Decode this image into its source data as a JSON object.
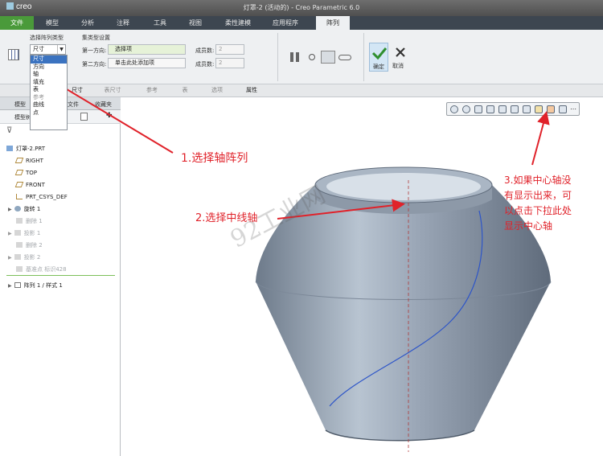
{
  "app": {
    "logo": "creo",
    "title": "灯罩-2 (活动的) - Creo Parametric 6.0"
  },
  "tabs": [
    "文件",
    "模型",
    "分析",
    "注释",
    "工具",
    "视图",
    "柔性建模",
    "应用程序",
    "阵列"
  ],
  "ribbon": {
    "pattern_type_label": "选择阵列类型",
    "pattern_type_value": "尺寸",
    "set_type_label": "集类型设置",
    "dir1_label": "第一方向:",
    "dir1_value": "选择项",
    "dir2_label": "第二方向:",
    "dir2_value": "单击此处添加项",
    "members_label1": "成员数:",
    "members_label2": "成员数:",
    "members_value1": "2",
    "members_value2": "2",
    "ok_label": "确定",
    "cancel_label": "取消"
  },
  "dropdown": {
    "items": [
      "尺寸",
      "方向",
      "轴",
      "填充",
      "表",
      "参考",
      "曲线",
      "点"
    ]
  },
  "subtabs": [
    "尺寸",
    "表尺寸",
    "参考",
    "表",
    "选项",
    "属性"
  ],
  "panel": {
    "tabs": [
      "模型",
      "文件",
      "收藏夹"
    ],
    "tree_label": "模型树",
    "items": [
      "灯罩-2.PRT",
      "RIGHT",
      "TOP",
      "FRONT",
      "PRT_CSYS_DEF",
      "旋转 1",
      "删除 1",
      "投影 1",
      "删除 2",
      "投影 2",
      "基准点 标识428",
      "阵列 1 / 样式 1"
    ]
  },
  "annotations": {
    "a1": "1.选择轴阵列",
    "a2": "2.选择中线轴",
    "a3_line1": "3.如果中心轴没",
    "a3_line2": "有显示出来，可",
    "a3_line3": "以点击下拉此处",
    "a3_line4": "显示中心轴"
  },
  "watermark": "92工业网",
  "colors": {
    "file_tab": "#4a9a3a",
    "annotation": "#e0222a",
    "selection": "#3b73c0",
    "model_body": "#8e9aaa",
    "ok_check": "#2f8f2f"
  }
}
